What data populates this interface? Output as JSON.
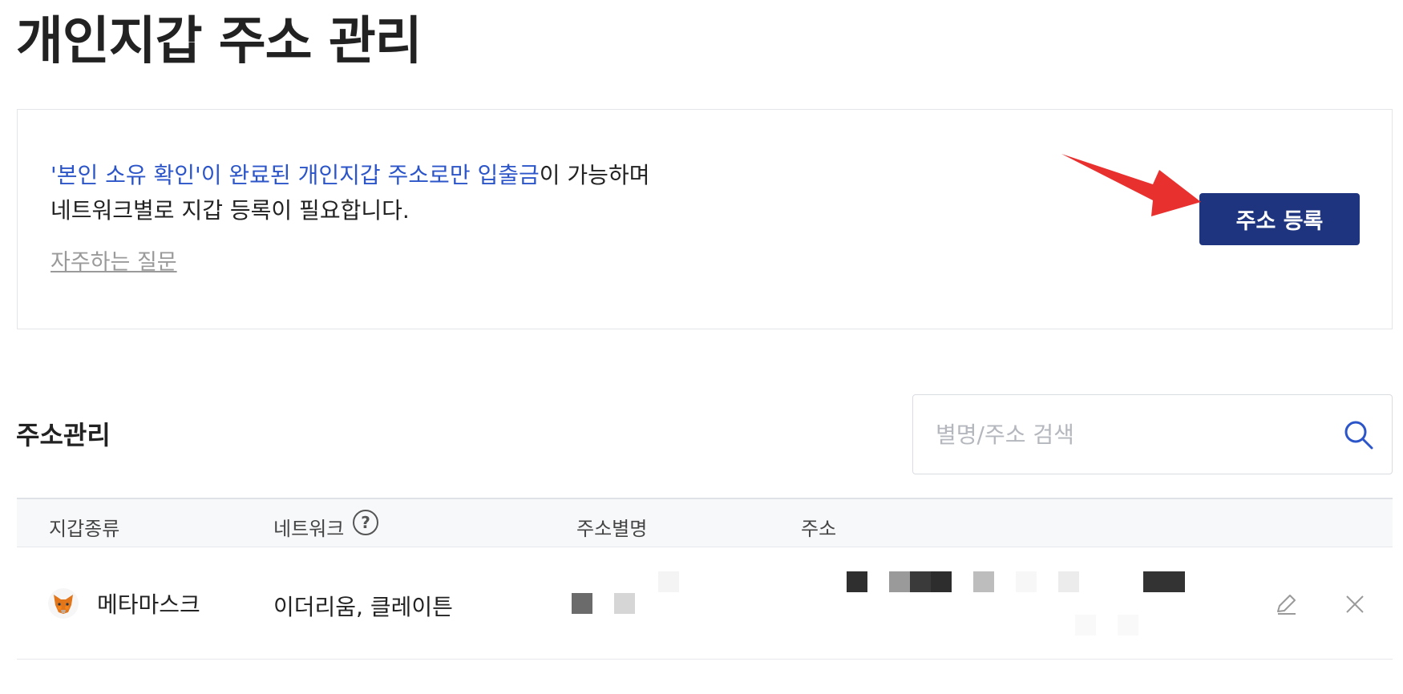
{
  "page": {
    "title": "개인지갑 주소 관리"
  },
  "notice": {
    "highlight": "'본인 소유 확인'이 완료된 개인지갑 주소로만 입출금",
    "line1_rest": "이 가능하며",
    "line2": "네트워크별로 지갑 등록이 필요합니다.",
    "faq_label": "자주하는 질문",
    "register_label": "주소 등록"
  },
  "address_section": {
    "title": "주소관리",
    "search_placeholder": "별명/주소 검색"
  },
  "table": {
    "columns": [
      "지갑종류",
      "네트워크",
      "주소별명",
      "주소"
    ],
    "help_symbol": "?",
    "rows": [
      {
        "wallet": "메타마스크",
        "network": "이더리움, 클레이튼",
        "alias": "",
        "address": ""
      }
    ]
  },
  "colors": {
    "accent_blue": "#2b55c8",
    "button_navy": "#1e347f",
    "arrow_red": "#e8312f"
  },
  "icons": [
    "search-icon",
    "help-icon",
    "metamask-fox-icon",
    "edit-pencil-icon",
    "close-x-icon",
    "red-arrow-annotation"
  ]
}
